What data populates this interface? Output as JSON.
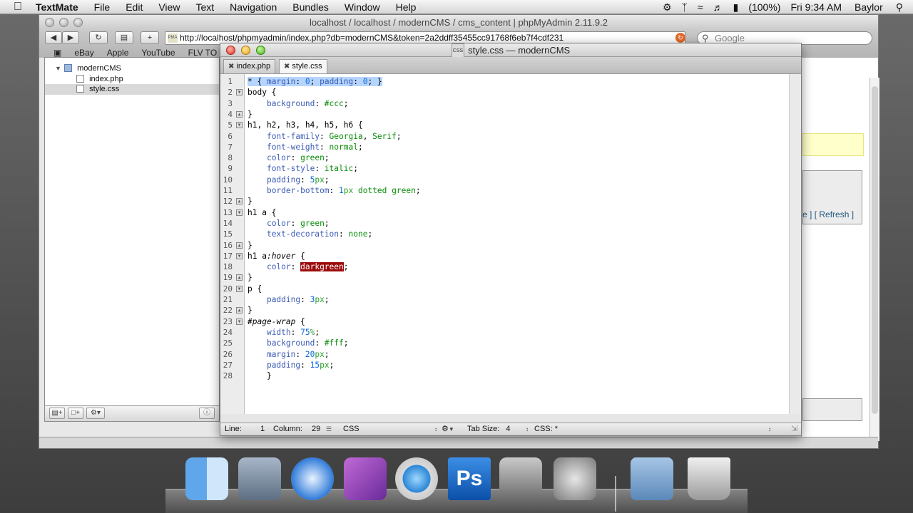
{
  "menubar": {
    "app_name": "TextMate",
    "menus": [
      "File",
      "Edit",
      "View",
      "Text",
      "Navigation",
      "Bundles",
      "Window",
      "Help"
    ],
    "battery": "(100%)",
    "clock": "Fri 9:34 AM",
    "user": "Baylor"
  },
  "browser": {
    "title": "localhost / localhost / modernCMS / cms_content | phpMyAdmin 2.11.9.2",
    "url": "http://localhost/phpmyadmin/index.php?db=modernCMS&token=2a2ddff35455cc91768f6eb7f4cdf231",
    "search_placeholder": "Google",
    "bookmarks": [
      "eBay",
      "Apple",
      "YouTube",
      "FLV TO"
    ],
    "refresh_link": "[ Refresh ]"
  },
  "drawer": {
    "project": "modernCMS",
    "files": [
      "index.php",
      "style.css"
    ],
    "selected": "style.css"
  },
  "editor": {
    "title": "style.css — modernCMS",
    "tabs": [
      "index.php",
      "style.css"
    ],
    "status": {
      "line_label": "Line:",
      "line": "1",
      "column_label": "Column:",
      "column": "29",
      "language": "CSS",
      "tab_size_label": "Tab Size:",
      "tab_size": "4",
      "symbol": "CSS: *"
    },
    "code_lines": [
      "* { margin: 0; padding: 0; }",
      "body {",
      "    background: #ccc;",
      "}",
      "h1, h2, h3, h4, h5, h6 {",
      "    font-family: Georgia, Serif;",
      "    font-weight: normal;",
      "    color: green;",
      "    font-style: italic;",
      "    padding: 5px;",
      "    border-bottom: 1px dotted green;",
      "}",
      "h1 a {",
      "    color: green;",
      "    text-decoration: none;",
      "}",
      "h1 a:hover {",
      "    color: darkgreen;",
      "}",
      "p {",
      "    padding: 3px;",
      "}",
      "#page-wrap {",
      "    width: 75%;",
      "    background: #fff;",
      "    margin: 20px;",
      "    padding: 15px;",
      "    }"
    ],
    "fold_lines": [
      2,
      4,
      5,
      12,
      13,
      16,
      17,
      19,
      20,
      22,
      23
    ]
  },
  "dock": {
    "items": [
      "finder-icon",
      "mail-icon",
      "safari-icon",
      "iphoto-icon",
      "itunes-icon",
      "photoshop-icon",
      "imovie-icon",
      "system-preferences-icon",
      "downloads-icon",
      "trash-icon"
    ],
    "photoshop_label": "Ps"
  }
}
